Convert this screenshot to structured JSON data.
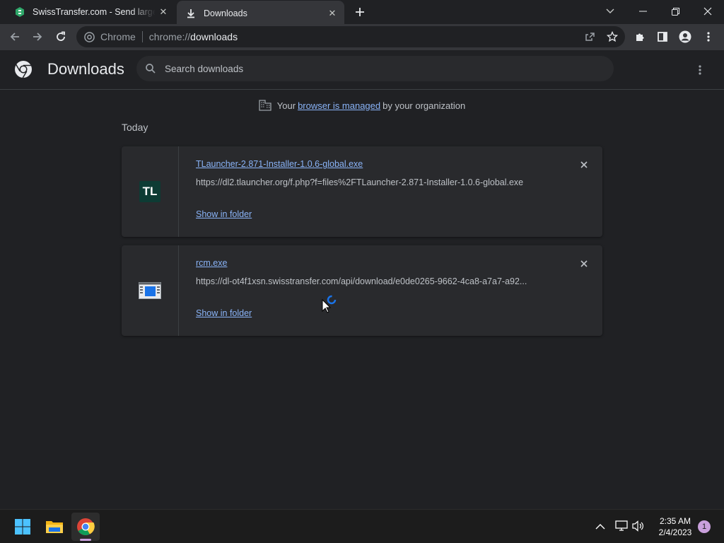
{
  "tabs": [
    {
      "title": "SwissTransfer.com - Send large fi",
      "active": false
    },
    {
      "title": "Downloads",
      "active": true
    }
  ],
  "omnibox": {
    "chip": "Chrome",
    "scheme": "chrome://",
    "host": "downloads"
  },
  "page": {
    "title": "Downloads",
    "search_placeholder": "Search downloads",
    "managed": {
      "prefix": "Your",
      "link": "browser is managed",
      "suffix": "by your organization"
    },
    "section": "Today"
  },
  "downloads": [
    {
      "icon_text": "TL",
      "filename": "TLauncher-2.871-Installer-1.0.6-global.exe",
      "url": "https://dl2.tlauncher.org/f.php?f=files%2FTLauncher-2.871-Installer-1.0.6-global.exe",
      "action": "Show in folder"
    },
    {
      "icon_text": "",
      "filename": "rcm.exe",
      "url": "https://dl-ot4f1xsn.swisstransfer.com/api/download/e0de0265-9662-4ca8-a7a7-a92...",
      "action": "Show in folder"
    }
  ],
  "taskbar": {
    "time": "2:35 AM",
    "date": "2/4/2023",
    "notifications": "1"
  },
  "colors": {
    "accent": "#8ab4f8",
    "background": "#202124",
    "card": "#292a2d"
  }
}
